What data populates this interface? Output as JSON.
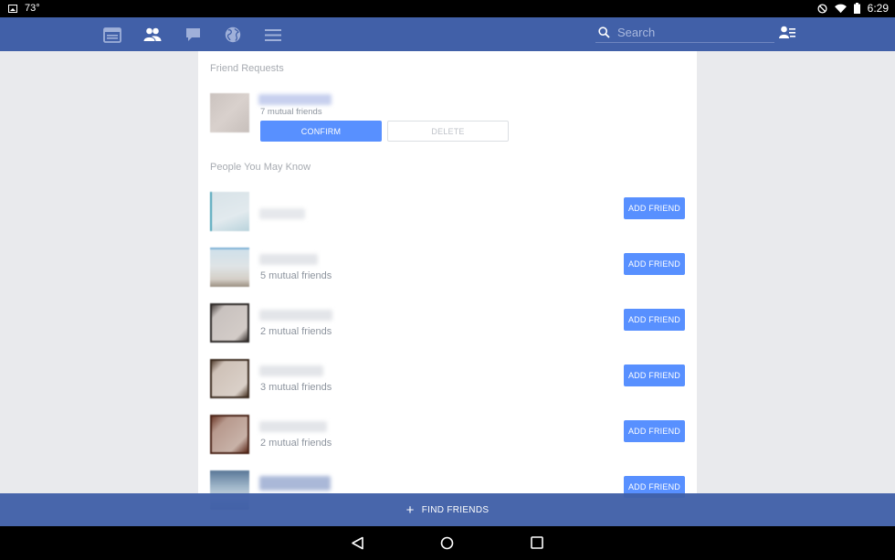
{
  "status_bar": {
    "temperature": "73°",
    "time": "6:29",
    "left_icons": [
      "image-icon"
    ],
    "right_icons": [
      "do-not-disturb-icon",
      "wifi-icon",
      "battery-icon"
    ]
  },
  "navbar": {
    "icons": [
      "news-feed-icon",
      "friends-icon",
      "messages-icon",
      "globe-icon",
      "menu-icon"
    ],
    "active": "friends-icon",
    "search_placeholder": "Search",
    "colors": {
      "bar": "#4160a8",
      "active_icon": "#ffffff",
      "inactive_icon": "#9fb0d9"
    }
  },
  "friend_requests": {
    "title": "Friend Requests",
    "items": [
      {
        "mutual": "7 mutual friends",
        "confirm_label": "CONFIRM",
        "delete_label": "DELETE"
      }
    ]
  },
  "people_you_may_know": {
    "title": "People You May Know",
    "add_label": "ADD FRIEND",
    "items": [
      {
        "mutual": ""
      },
      {
        "mutual": "5 mutual friends"
      },
      {
        "mutual": "2 mutual friends"
      },
      {
        "mutual": "3 mutual friends"
      },
      {
        "mutual": "2 mutual friends"
      },
      {
        "mutual": ""
      }
    ]
  },
  "find_friends": {
    "label": "FIND FRIENDS"
  },
  "android_nav": {
    "icons": [
      "back-icon",
      "home-icon",
      "recents-icon"
    ]
  },
  "colors": {
    "accent": "#5890ff",
    "page_bg": "#e9eaed"
  }
}
